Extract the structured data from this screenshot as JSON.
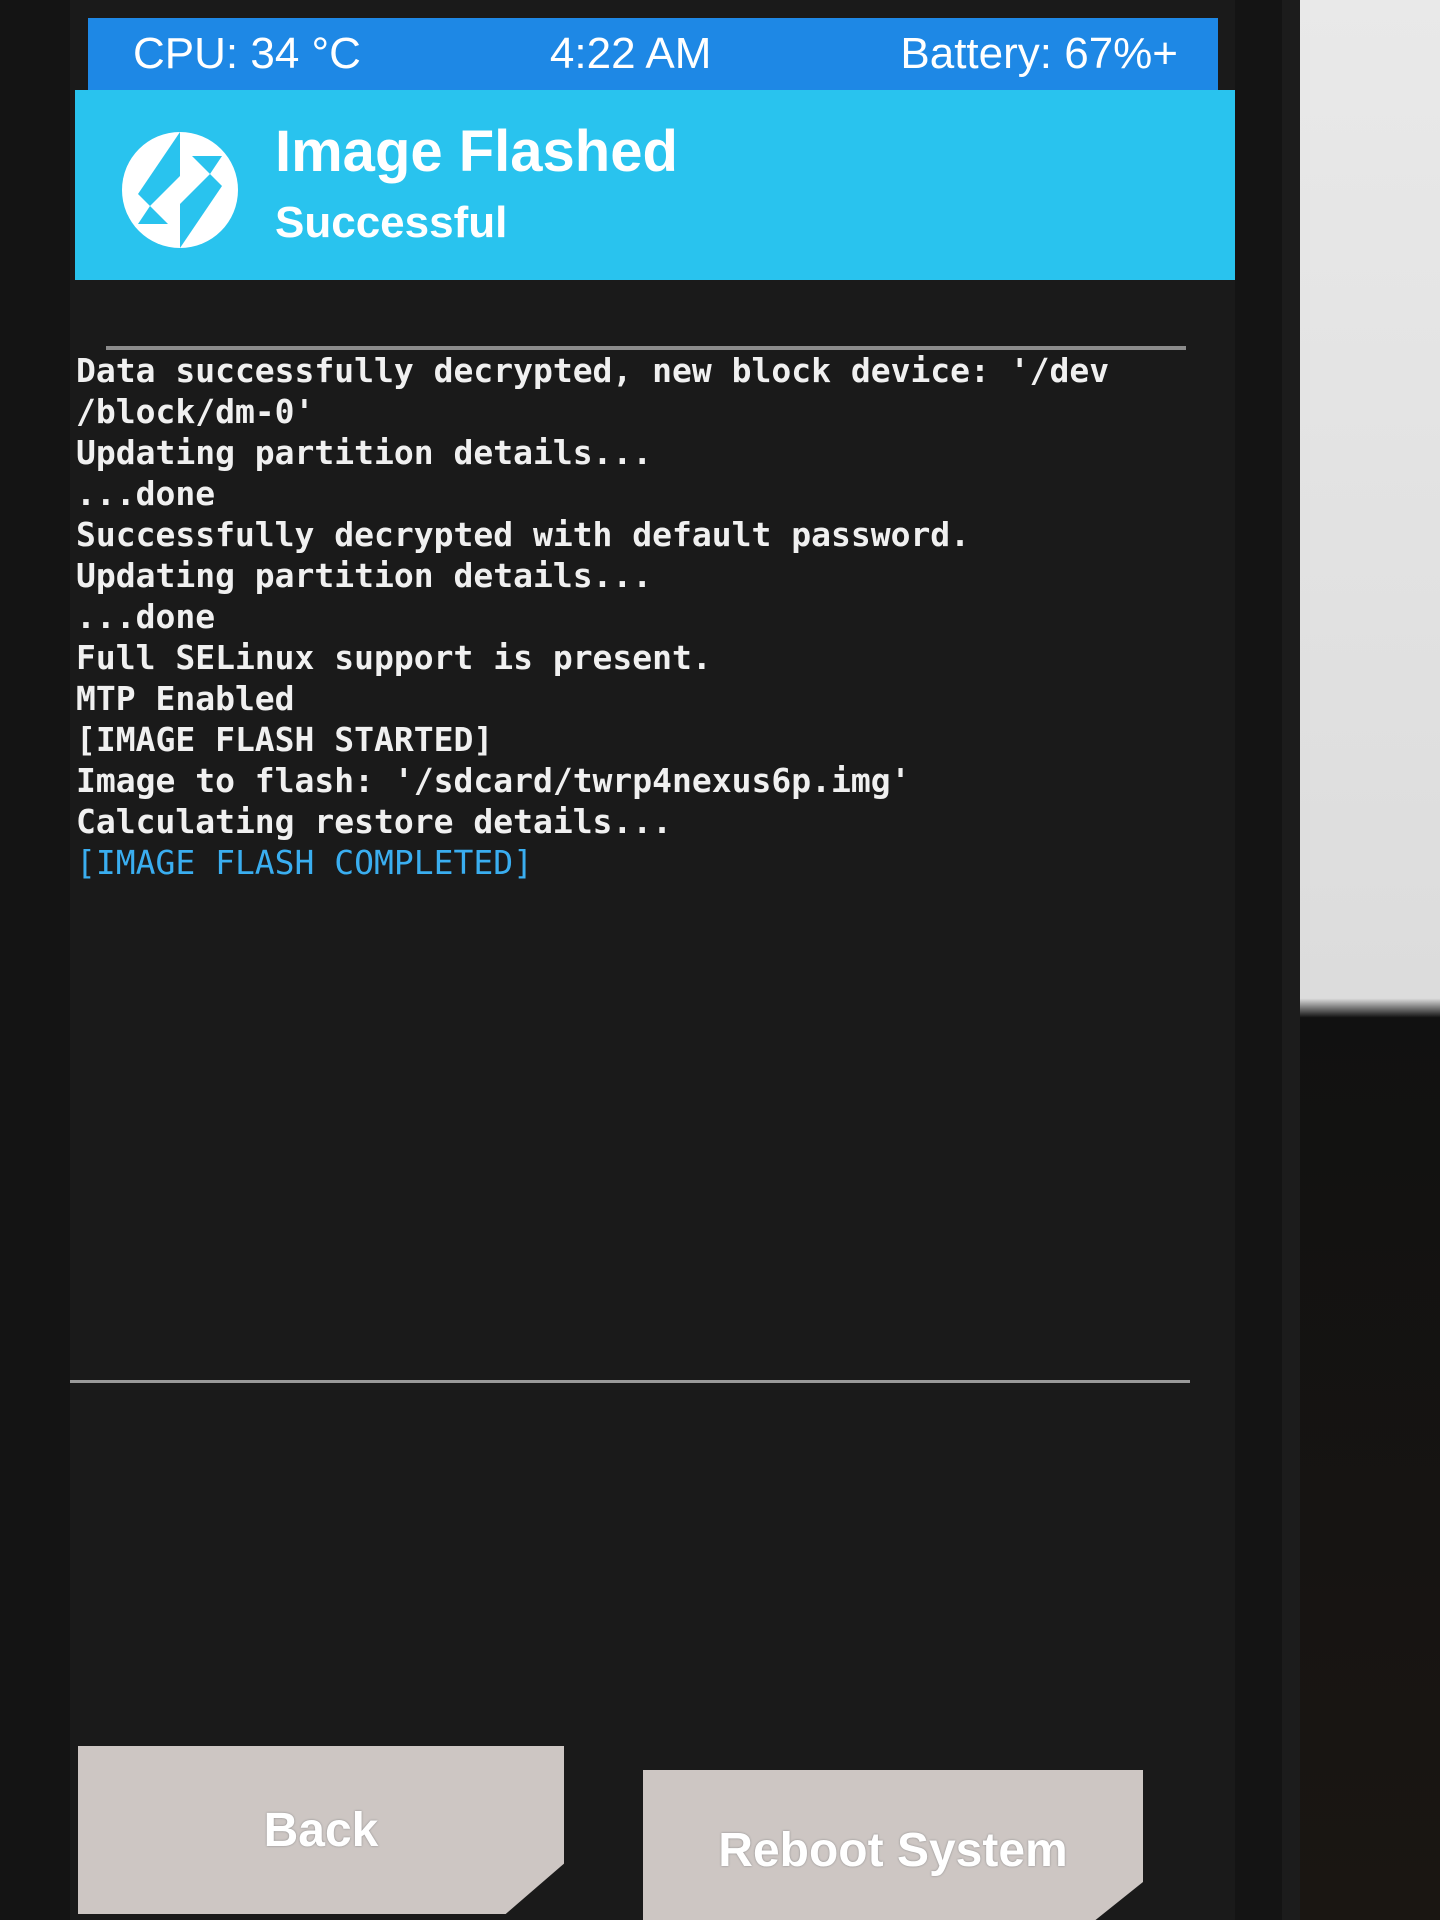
{
  "status_bar": {
    "cpu": "CPU: 34 °C",
    "time": "4:22 AM",
    "battery": "Battery: 67%+"
  },
  "header": {
    "logo_icon": "twrp-logo-icon",
    "title": "Image Flashed",
    "subtitle": "Successful"
  },
  "console": {
    "lines": [
      "Data successfully decrypted, new block device: '/dev",
      "/block/dm-0'",
      "Updating partition details...",
      "...done",
      "Successfully decrypted with default password.",
      "Updating partition details...",
      "...done",
      "Full SELinux support is present.",
      "MTP Enabled",
      "[IMAGE FLASH STARTED]",
      "Image to flash: '/sdcard/twrp4nexus6p.img'",
      "Calculating restore details...",
      "[IMAGE FLASH COMPLETED]"
    ],
    "highlight_color": "#3aaef0"
  },
  "buttons": {
    "back_label": "Back",
    "reboot_label": "Reboot System"
  },
  "colors": {
    "status_bar": "#1e88e5",
    "header": "#29c3ee",
    "button": "#cdc6c3"
  }
}
